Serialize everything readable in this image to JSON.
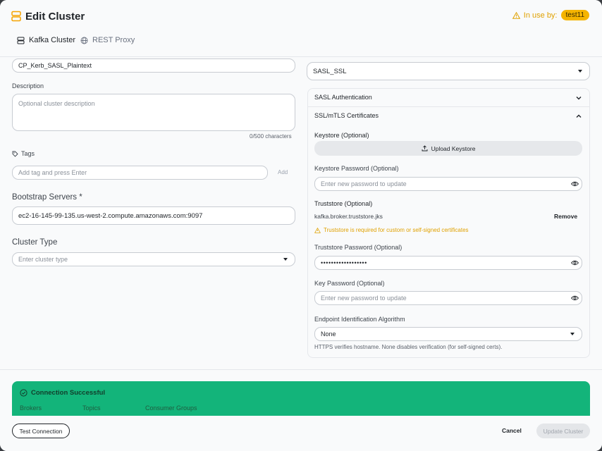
{
  "header": {
    "title": "Edit Cluster",
    "in_use_label": "In use by:",
    "in_use_badge": "test11"
  },
  "tabs": [
    {
      "label": "Kafka Cluster",
      "icon": "server-icon",
      "active": true
    },
    {
      "label": "REST Proxy",
      "icon": "globe-icon",
      "active": false
    }
  ],
  "left": {
    "cluster_name_value": "CP_Kerb_SASL_Plaintext",
    "description_label": "Description",
    "description_placeholder": "Optional cluster description",
    "char_count": "0/500 characters",
    "tags_label": "Tags",
    "tags_placeholder": "Add tag and press Enter",
    "add_button": "Add",
    "bootstrap_label": "Bootstrap Servers *",
    "bootstrap_value": "ec2-16-145-99-135.us-west-2.compute.amazonaws.com:9097",
    "cluster_type_label": "Cluster Type",
    "cluster_type_placeholder": "Enter cluster type"
  },
  "right": {
    "security_protocol": "SASL_SSL",
    "sasl_auth_label": "SASL Authentication",
    "ssl_label": "SSL/mTLS Certificates",
    "keystore_label": "Keystore (Optional)",
    "upload_keystore": "Upload Keystore",
    "keystore_password_label": "Keystore Password (Optional)",
    "keystore_password_placeholder": "Enter new password to update",
    "truststore_label": "Truststore (Optional)",
    "truststore_file": "kafka.broker.truststore.jks",
    "remove_button": "Remove",
    "truststore_warning": "Truststore is required for custom or self-signed certificates",
    "truststore_password_label": "Truststore Password (Optional)",
    "truststore_password_value": "••••••••••••••••••",
    "key_password_label": "Key Password (Optional)",
    "key_password_placeholder": "Enter new password to update",
    "endpoint_label": "Endpoint Identification Algorithm",
    "endpoint_value": "None",
    "endpoint_help": "HTTPS verifies hostname. None disables verification (for self-signed certs)."
  },
  "status": {
    "title": "Connection Successful",
    "tabs": [
      "Brokers",
      "Topics",
      "Consumer Groups"
    ]
  },
  "footer": {
    "test_connection": "Test Connection",
    "cancel": "Cancel",
    "update": "Update Cluster"
  },
  "colors": {
    "accent": "#f5b400",
    "success": "#13b47a",
    "warning": "#e0a100"
  }
}
